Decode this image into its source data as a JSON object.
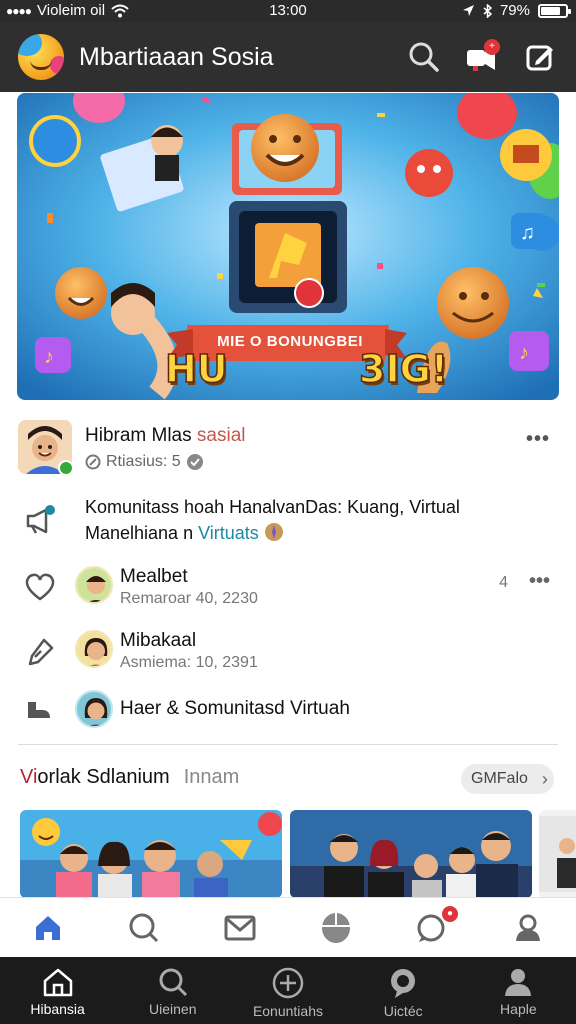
{
  "status_bar": {
    "carrier": "Violeim oil",
    "time": "13:00",
    "battery": "79%",
    "battery_level": 0.79
  },
  "app_bar": {
    "title": "Mbartiaaan Sosia"
  },
  "banner": {
    "hu_text": "HU",
    "sig_text": "3IG!",
    "ribbon_text": "MIE O BONUNGBEI"
  },
  "post": {
    "author_main": "Hibram Mlas",
    "author_alt": "sasial",
    "meta": "Rtiasius: 5",
    "text_main": "Komunitass hoah HanalvanDas: Kuang, Virtual Manelhiana n",
    "text_link": "Virtuats"
  },
  "comments": [
    {
      "name": "Mealbet",
      "meta": "Remaroar 40, 2230",
      "count": "4"
    },
    {
      "name": "Mibakaal",
      "meta": "Asmiema: 10, 2391"
    },
    {
      "text": "Haer & Somunitasd Virtuah"
    }
  ],
  "section": {
    "title_red": "Vi",
    "title_rest": "orlak Sdlanium",
    "subtitle": "Innam",
    "pill_label": "GMFalo"
  },
  "bottom_nav": [
    {
      "label": "Hibansia",
      "icon": "home-icon"
    },
    {
      "label": "Uieinen",
      "icon": "search-icon"
    },
    {
      "label": "Eonuntiahs",
      "icon": "plus-circle-icon"
    },
    {
      "label": "Uictéc",
      "icon": "chat-icon"
    },
    {
      "label": "Haple",
      "icon": "profile-icon"
    }
  ],
  "colors": {
    "appbar": "#2f2f2f",
    "accent_blue": "#3b6fd6",
    "link": "#1a8aa8",
    "red": "#b3262c"
  }
}
